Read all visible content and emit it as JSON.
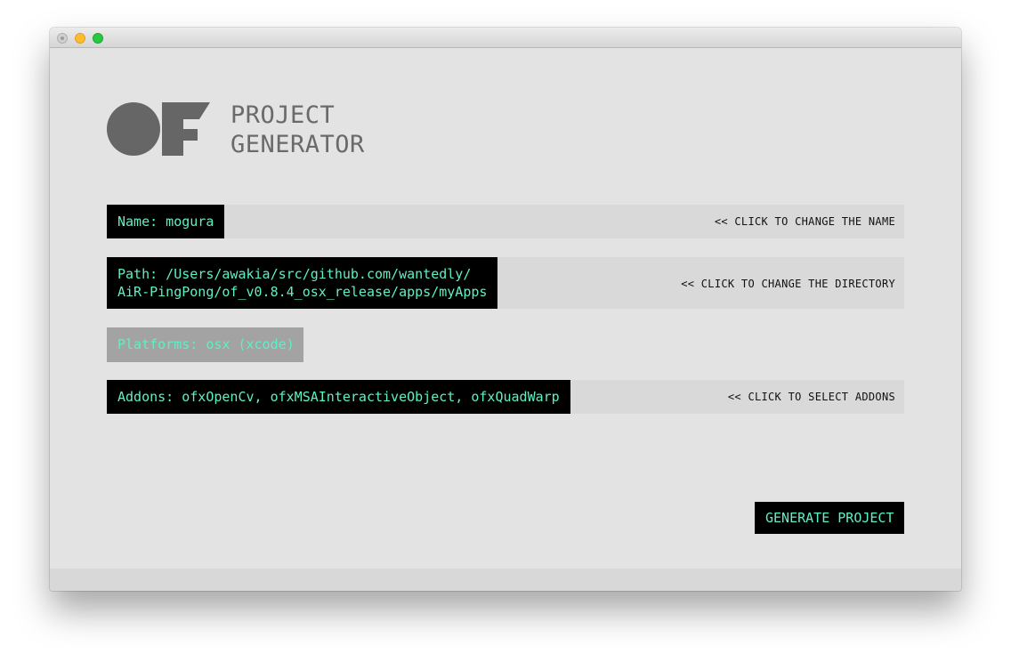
{
  "window": {
    "traffic_lights": [
      "close-button",
      "minimize-button",
      "maximize-button"
    ]
  },
  "logo": {
    "line1": "PROJECT",
    "line2": "GENERATOR",
    "color": "#666666"
  },
  "name_row": {
    "value": "Name: mogura",
    "hint": "<< CLICK TO CHANGE THE NAME"
  },
  "path_row": {
    "line1": "Path: /Users/awakia/src/github.com/wantedly/",
    "line2": "AiR-PingPong/of_v0.8.4_osx_release/apps/myApps",
    "hint": "<< CLICK TO CHANGE THE DIRECTORY"
  },
  "platforms": {
    "value": "Platforms: osx (xcode)"
  },
  "addons_row": {
    "value": "Addons: ofxOpenCv, ofxMSAInteractiveObject, ofxQuadWarp",
    "hint": "<< CLICK TO SELECT ADDONS"
  },
  "generate": {
    "label": "GENERATE PROJECT"
  },
  "colors": {
    "accent_text": "#5ef0c4",
    "box_bg": "#000000",
    "window_bg": "#e3e3e3",
    "row_bg": "#d9d9d9",
    "platforms_bg": "#a3a3a3"
  }
}
